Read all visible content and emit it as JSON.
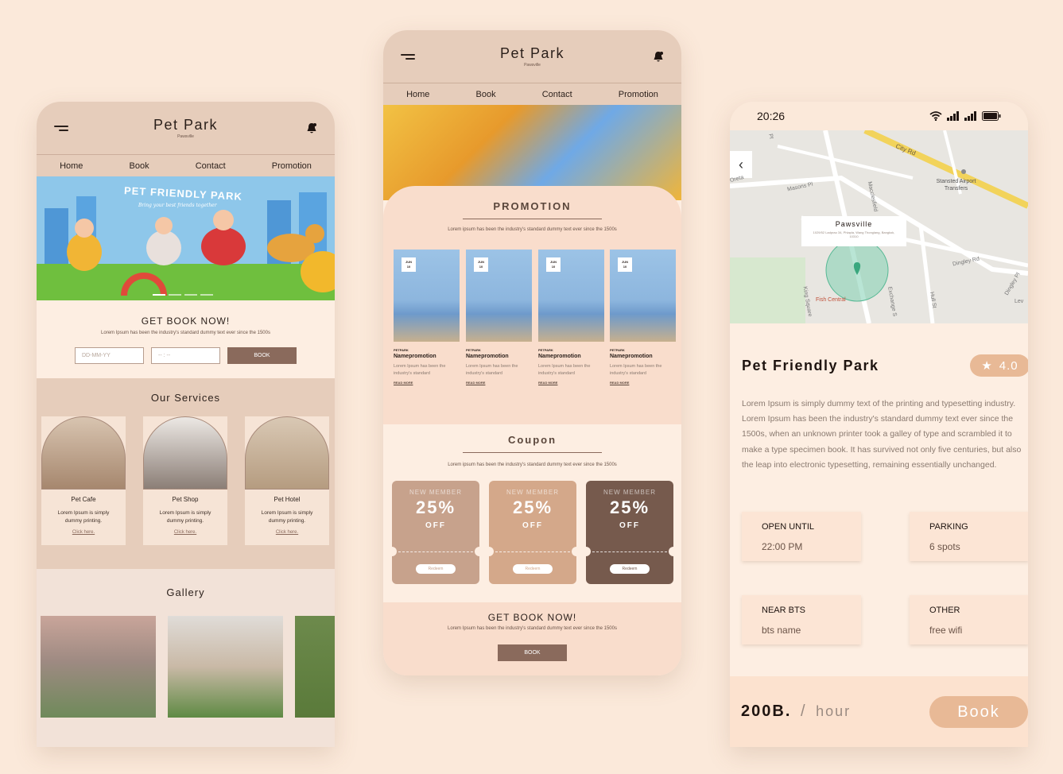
{
  "app": {
    "title": "Pet Park",
    "subtitle": "Pawsville"
  },
  "nav": {
    "home": "Home",
    "book": "Book",
    "contact": "Contact",
    "promotion": "Promotion"
  },
  "status": {
    "time": "20:26"
  },
  "left": {
    "hero_title": "PET FRIENDLY PARK",
    "hero_subtitle": "Bring your best friends together",
    "book": {
      "heading": "GET BOOK NOW!",
      "desc": "Lorem Ipsum has been the industry's standard dummy text ever since the 1500s",
      "date_placeholder": "DD-MM-YY",
      "time_placeholder": "-- : --",
      "button": "BOOK"
    },
    "services_title": "Our Services",
    "services": [
      {
        "name": "Pet Cafe",
        "desc": "Lorem Ipsum is simply dummy printing.",
        "link": "Click here."
      },
      {
        "name": "Pet Shop",
        "desc": "Lorem Ipsum is simply dummy printing.",
        "link": "Click here."
      },
      {
        "name": "Pet Hotel",
        "desc": "Lorem Ipsum is simply dummy printing.",
        "link": "Click here."
      }
    ],
    "gallery_title": "Gallery"
  },
  "middle": {
    "promotion_title": "PROMOTION",
    "promotion_desc": "Lorem ipsum has been the industry's standard dummy text ever since the 1500s",
    "promos": [
      {
        "date_month": "JUN",
        "date_day": "10",
        "brand": "PETPARK",
        "name": "Namepromotion",
        "desc": "Lorem Ipsum has been the industry's standard",
        "more": "READ MORE"
      },
      {
        "date_month": "JUN",
        "date_day": "10",
        "brand": "PETPARK",
        "name": "Namepromotion",
        "desc": "Lorem Ipsum has been the industry's standard",
        "more": "READ MORE"
      },
      {
        "date_month": "JUN",
        "date_day": "10",
        "brand": "PETPARK",
        "name": "Namepromotion",
        "desc": "Lorem Ipsum has been the industry's standard",
        "more": "READ MORE"
      },
      {
        "date_month": "JUN",
        "date_day": "10",
        "brand": "PETPARK",
        "name": "Namepromotion",
        "desc": "Lorem Ipsum has been the industry's standard",
        "more": "READ MORE"
      }
    ],
    "coupon_title": "Coupon",
    "coupon_desc": "Lorem ipsum has been the industry's standard dummy text ever since the 1500s",
    "coupons": [
      {
        "label": "NEW MEMBER",
        "percent": "25%",
        "off": "OFF",
        "redeem": "Redeem",
        "color": "#c7a28c"
      },
      {
        "label": "NEW MEMBER",
        "percent": "25%",
        "off": "OFF",
        "redeem": "Redeem",
        "color": "#d4a88a"
      },
      {
        "label": "NEW MEMBER",
        "percent": "25%",
        "off": "OFF",
        "redeem": "Redeem",
        "color": "#765a4d"
      }
    ],
    "book": {
      "heading": "GET BOOK NOW!",
      "desc": "Lorem Ipsum has been the industry's standard dummy text ever since the 1500s",
      "button": "BOOK"
    }
  },
  "right": {
    "map": {
      "label_title": "Pawsville",
      "label_address": "1029/52 Ladprao 34, Phlapla, Wang Thonglang, Bangkok, 10310",
      "streets": [
        "City Rd",
        "Masons Pl",
        "Macclesfield",
        "Dingley Rd",
        "Dingley Pl",
        "Exchange S",
        "Hull St",
        "King Square",
        "Fish Central",
        "Stansted Airport Transfers",
        "Lev",
        "Pl",
        "Oreta"
      ]
    },
    "place_name": "Pet Friendly Park",
    "rating": "4.0",
    "description": "Lorem Ipsum is simply dummy text of the printing and typesetting industry. Lorem Ipsum has been the industry's standard dummy text ever since the 1500s, when an unknown printer took a galley of type and scrambled it to make a type specimen book. It has survived not only five centuries, but also the leap into electronic typesetting, remaining essentially unchanged.",
    "info": [
      {
        "key": "OPEN UNTIL",
        "value": "22:00 PM"
      },
      {
        "key": "PARKING",
        "value": "6 spots"
      },
      {
        "key": "NEAR BTS",
        "value": "bts name"
      },
      {
        "key": "OTHER",
        "value": "free wifi"
      }
    ],
    "price": "200B.",
    "price_sep": "/",
    "price_unit": "hour",
    "book_button": "Book"
  }
}
